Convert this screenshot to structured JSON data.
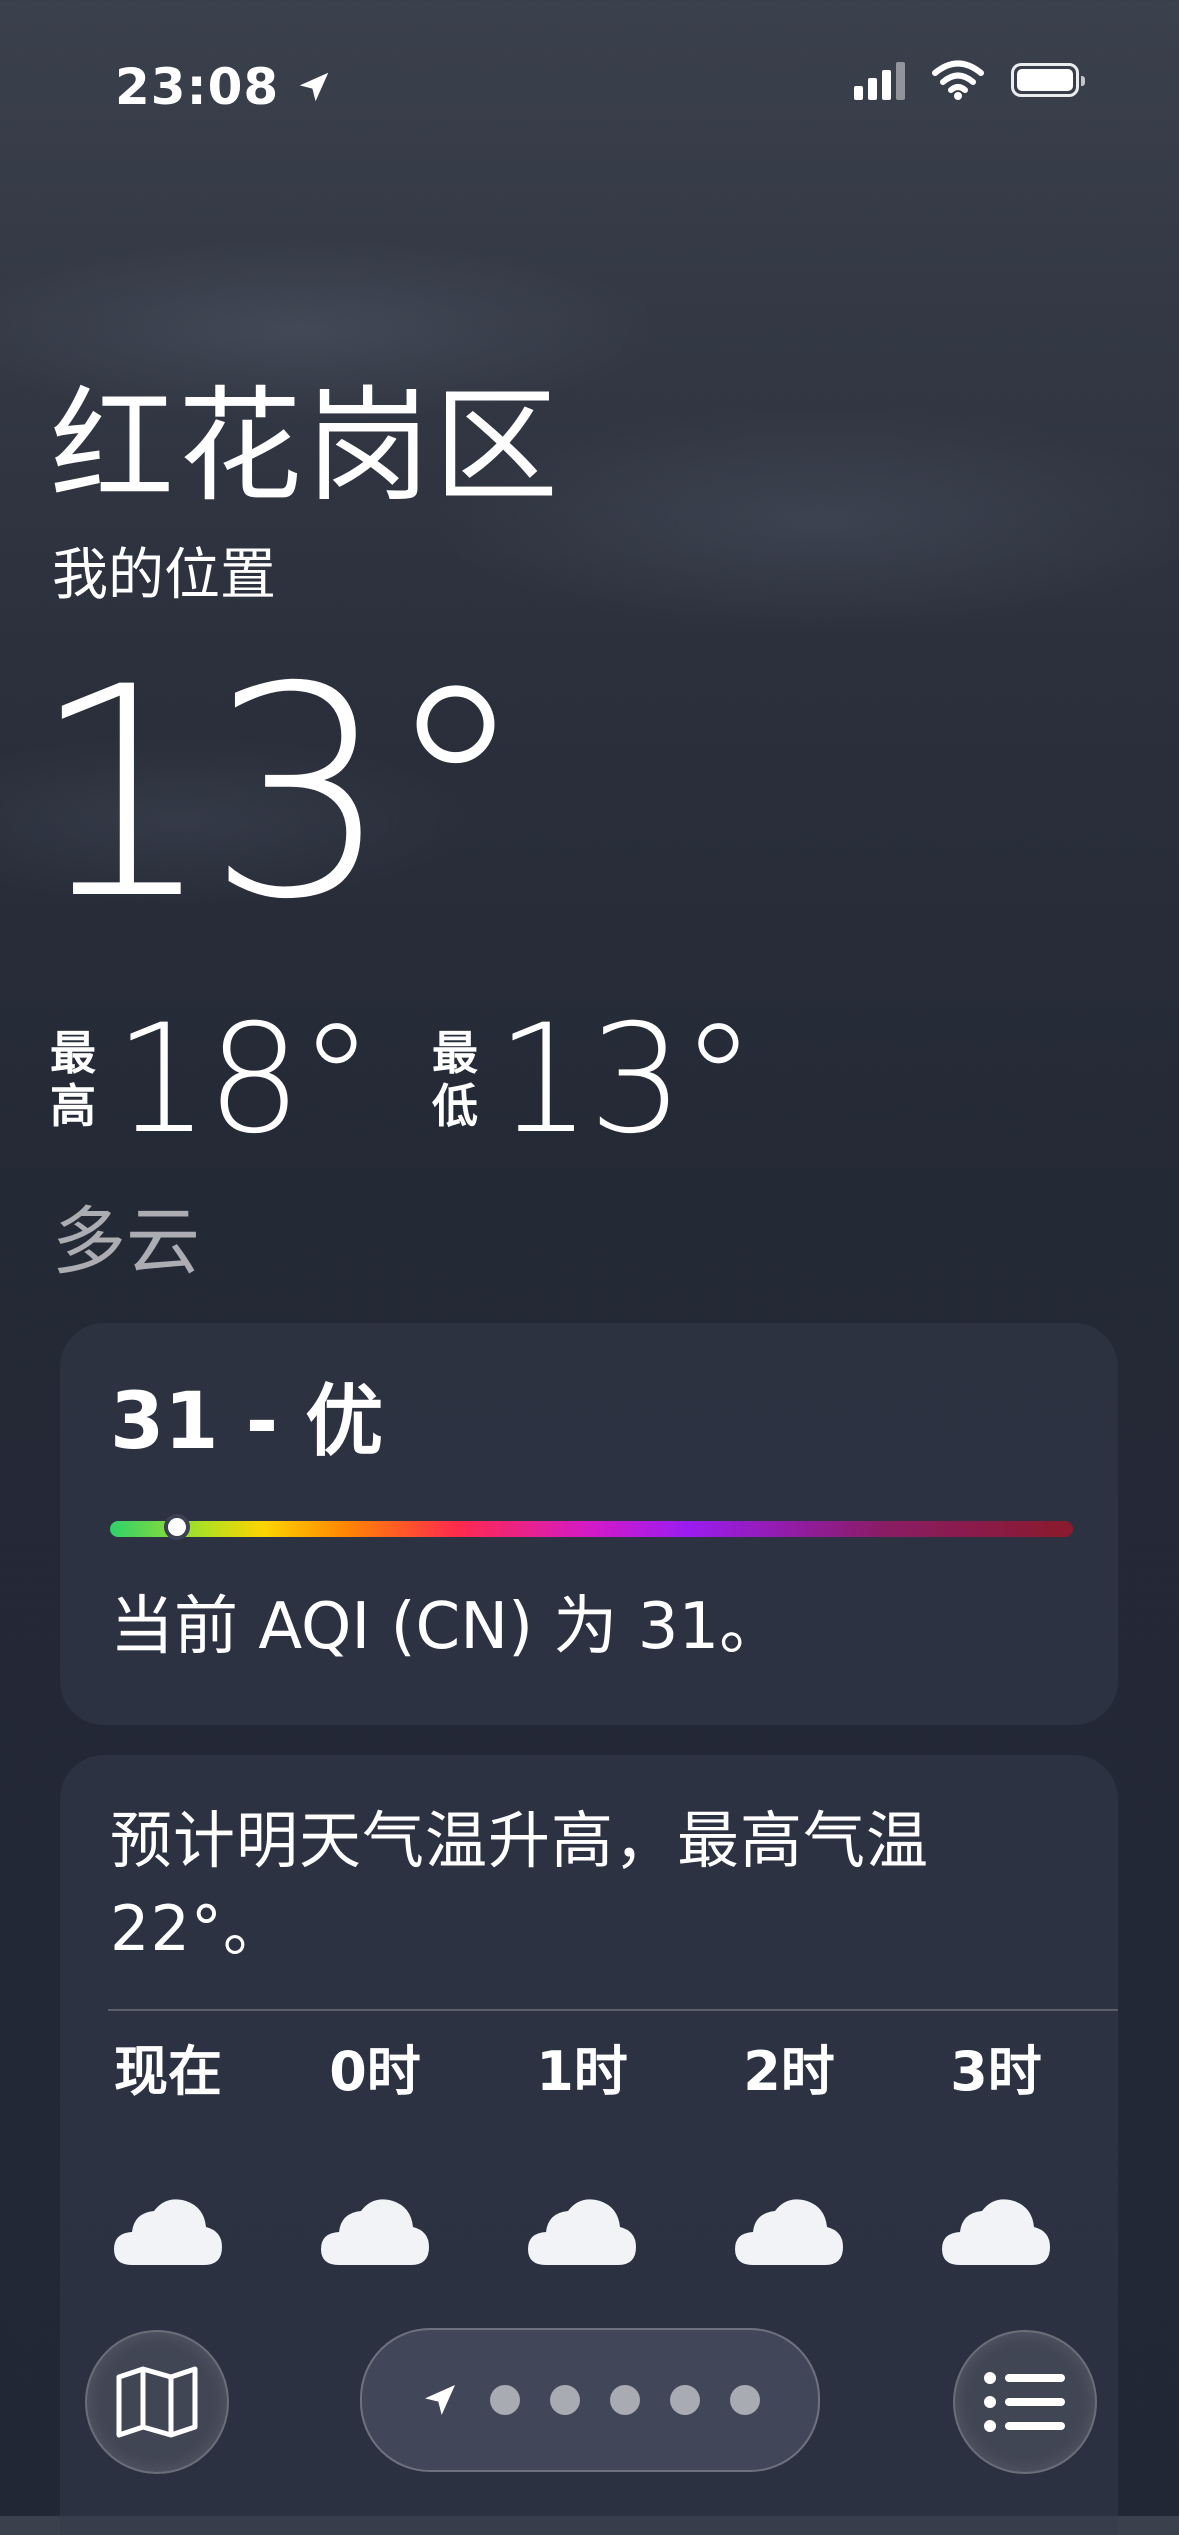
{
  "status_bar": {
    "time": "23:08",
    "location_arrow_icon": "location-arrow-icon",
    "battery_level": 1.0
  },
  "header": {
    "location": "红花岗区",
    "sublocation": "我的位置",
    "temperature": "13°",
    "high_label": "最高",
    "high_label_chars": [
      "最",
      "高"
    ],
    "high": "18°",
    "low_label": "最低",
    "low_label_chars": [
      "最",
      "低"
    ],
    "low": "13°",
    "condition": "多云"
  },
  "aqi": {
    "value_label": "31 - 优",
    "description": "当前 AQI (CN) 为 31。",
    "level_fraction": 0.07
  },
  "forecast": {
    "summary": "预计明天气温升高，最高气温 22°。",
    "hours": [
      {
        "label": "现在",
        "icon": "cloud-icon"
      },
      {
        "label": "0时",
        "icon": "cloud-icon"
      },
      {
        "label": "1时",
        "icon": "cloud-icon"
      },
      {
        "label": "2时",
        "icon": "cloud-icon"
      },
      {
        "label": "3时",
        "icon": "cloud-icon"
      }
    ]
  },
  "toolbar": {
    "map_icon": "map-icon",
    "list_icon": "list-icon",
    "page_dots": 5,
    "current_page": 1,
    "current_page_icon": "location-arrow-icon"
  }
}
